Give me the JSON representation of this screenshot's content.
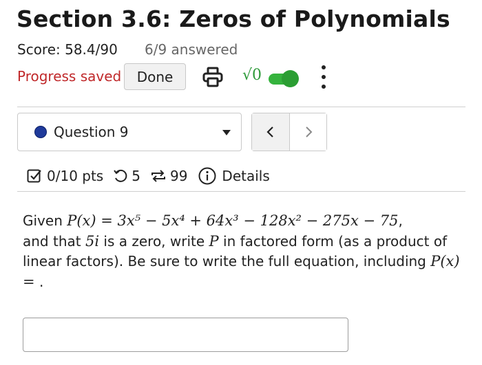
{
  "header": {
    "title": "Section 3.6: Zeros of Polynomials",
    "score": "Score: 58.4/90",
    "answered": "6/9 answered",
    "progress_status": "Progress saved",
    "done_label": "Done",
    "math_toggle_label": "√0",
    "math_toggle_on": true
  },
  "question_nav": {
    "selected": "Question 9",
    "status_color": "#1f3a9a",
    "prev_glyph": "<",
    "next_glyph": ">"
  },
  "meta": {
    "points": "0/10 pts",
    "retries": "5",
    "attempts": "99",
    "details_label": "Details"
  },
  "question": {
    "intro": "Given ",
    "polynomial": "P(x) = 3x⁵ − 5x⁴ + 64x³ − 128x² − 275x − 75",
    "after_poly": ",",
    "line2_prefix": "and that ",
    "zero": "5i",
    "line2_mid": " is a zero, write ",
    "var_p": "P",
    "line2_suffix": " in factored form (as a product of linear factors). Be sure to write the full equation, including ",
    "ending_math": "P(x) =",
    "ending_punct": " ."
  },
  "answer": {
    "value": ""
  },
  "colors": {
    "progress_saved": "#c0282a",
    "toggle_green": "#35b33d"
  }
}
